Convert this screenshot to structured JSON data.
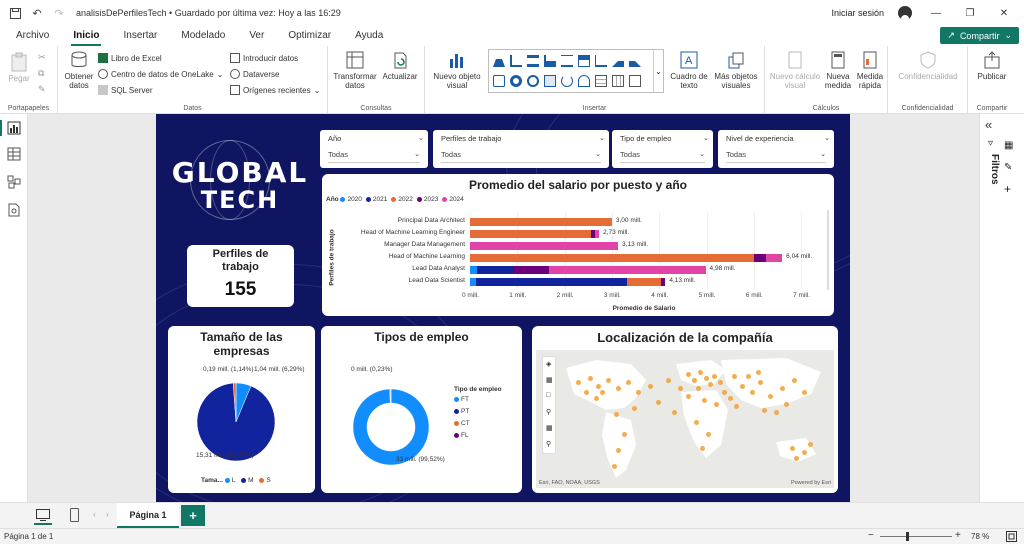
{
  "titlebar": {
    "title": "analisisDePerfilesTech • Guardado por última vez: Hoy a las 16:29",
    "signin": "Iniciar sesión"
  },
  "menu": {
    "items": [
      "Archivo",
      "Inicio",
      "Insertar",
      "Modelado",
      "Ver",
      "Optimizar",
      "Ayuda"
    ],
    "active": "Inicio",
    "share": "Compartir"
  },
  "ribbon": {
    "clipboard": {
      "paste": "Pegar",
      "label": "Portapapeles"
    },
    "data": {
      "get_data_1": "Obtener",
      "get_data_2": "datos",
      "excel": "Libro de Excel",
      "onelake": "Centro de datos de OneLake",
      "sql": "SQL Server",
      "enter": "Introducir datos",
      "dataverse": "Dataverse",
      "recent": "Orígenes recientes",
      "label": "Datos"
    },
    "queries": {
      "transform_1": "Transformar",
      "transform_2": "datos",
      "refresh": "Actualizar",
      "label": "Consultas"
    },
    "insert": {
      "new_visual_1": "Nuevo objeto",
      "new_visual_2": "visual",
      "textbox_1": "Cuadro de",
      "textbox_2": "texto",
      "more_1": "Más objetos",
      "more_2": "visuales",
      "label": "Insertar"
    },
    "calcs": {
      "new_calc_1": "Nuevo cálculo",
      "new_calc_2": "visual",
      "new_measure_1": "Nueva",
      "new_measure_2": "medida",
      "quick_1": "Medida",
      "quick_2": "rápida",
      "label": "Cálculos"
    },
    "sensitivity": {
      "btn": "Confidencialidad",
      "label": "Confidencialidad"
    },
    "share": {
      "publish": "Publicar",
      "label": "Compartir"
    }
  },
  "filters_pane": {
    "label": "Filtros"
  },
  "report": {
    "logo": {
      "line1": "GLOBAL",
      "line2": "TECH"
    },
    "slicers": [
      {
        "label": "Año",
        "value": "Todas"
      },
      {
        "label": "Perfiles de trabajo",
        "value": "Todas"
      },
      {
        "label": "Tipo de empleo",
        "value": "Todas"
      },
      {
        "label": "Nivel de experiencia",
        "value": "Todas"
      }
    ],
    "kpi": {
      "title": "Perfiles de trabajo",
      "value": "155"
    },
    "company_size": {
      "title": "Tamaño de las empresas",
      "legend_title": "Tama...",
      "legend": [
        "L",
        "M",
        "S"
      ],
      "labels": [
        "0,19 mill. (1,14%)",
        "1,04 mill. (6,29%)",
        "15,31 mill. (92,57%)"
      ]
    },
    "employment": {
      "title": "Tipos de empleo",
      "legend_title": "Tipo de empleo",
      "legend": [
        "FT",
        "PT",
        "CT",
        "FL"
      ],
      "labels": [
        "0 mill. (0,23%)",
        "33 mill. (99,52%)"
      ]
    },
    "map": {
      "title": "Localización de la compañía",
      "attribution": "Esri, FAO, NOAA, USGS",
      "powered": "Powered by Esri"
    }
  },
  "tabs": {
    "page": "Página 1",
    "add": "+"
  },
  "status": {
    "page": "Página 1 de 1",
    "zoom": "78 %"
  },
  "colors": {
    "y2020": "#118DFF",
    "y2021": "#12239E",
    "y2022": "#E66C37",
    "y2023": "#6B007B",
    "y2024": "#E044A7"
  },
  "chart_data": [
    {
      "type": "bar",
      "title": "Promedio del salario por puesto y año",
      "xlabel": "Promedio de Salario",
      "ylabel": "Perfiles de trabajo",
      "legend_title": "Año",
      "legend_placement": "top-left",
      "categories": [
        "Principal Data Architect",
        "Head of Machine Learning Engineer",
        "Manager Data Management",
        "Head of Machine Learning",
        "Lead Data Analyst",
        "Lead Data Scientist"
      ],
      "totals_labels": [
        "3,00 mill.",
        "2,73 mill.",
        "3,13 mill.",
        "6,04 mill.",
        "4,98 mill.",
        "4,13 mill."
      ],
      "series": [
        {
          "name": "2020",
          "values": [
            0,
            0,
            0,
            0,
            0.15,
            0.12
          ]
        },
        {
          "name": "2021",
          "values": [
            0,
            0,
            0,
            0,
            0.75,
            3.2
          ]
        },
        {
          "name": "2022",
          "values": [
            3.0,
            2.55,
            0,
            6.0,
            0,
            0.71
          ]
        },
        {
          "name": "2023",
          "values": [
            0,
            0.1,
            0,
            0.25,
            0.78,
            0.1
          ]
        },
        {
          "name": "2024",
          "values": [
            0,
            0.08,
            3.13,
            0.35,
            3.3,
            0
          ]
        }
      ],
      "xticks": [
        "0 mill.",
        "1 mill.",
        "2 mill.",
        "3 mill.",
        "4 mill.",
        "5 mill.",
        "6 mill.",
        "7 mill."
      ],
      "xlim": [
        0,
        7.3
      ]
    },
    {
      "type": "pie",
      "title": "Tamaño de las empresas",
      "categories": [
        "L",
        "M",
        "S"
      ],
      "values": [
        1.04,
        15.31,
        0.19
      ],
      "unit": "mill."
    },
    {
      "type": "pie",
      "title": "Tipos de empleo",
      "categories": [
        "FT",
        "PT",
        "CT",
        "FL"
      ],
      "values": [
        33,
        0.08,
        0.01,
        0.07
      ],
      "unit": "mill."
    }
  ]
}
